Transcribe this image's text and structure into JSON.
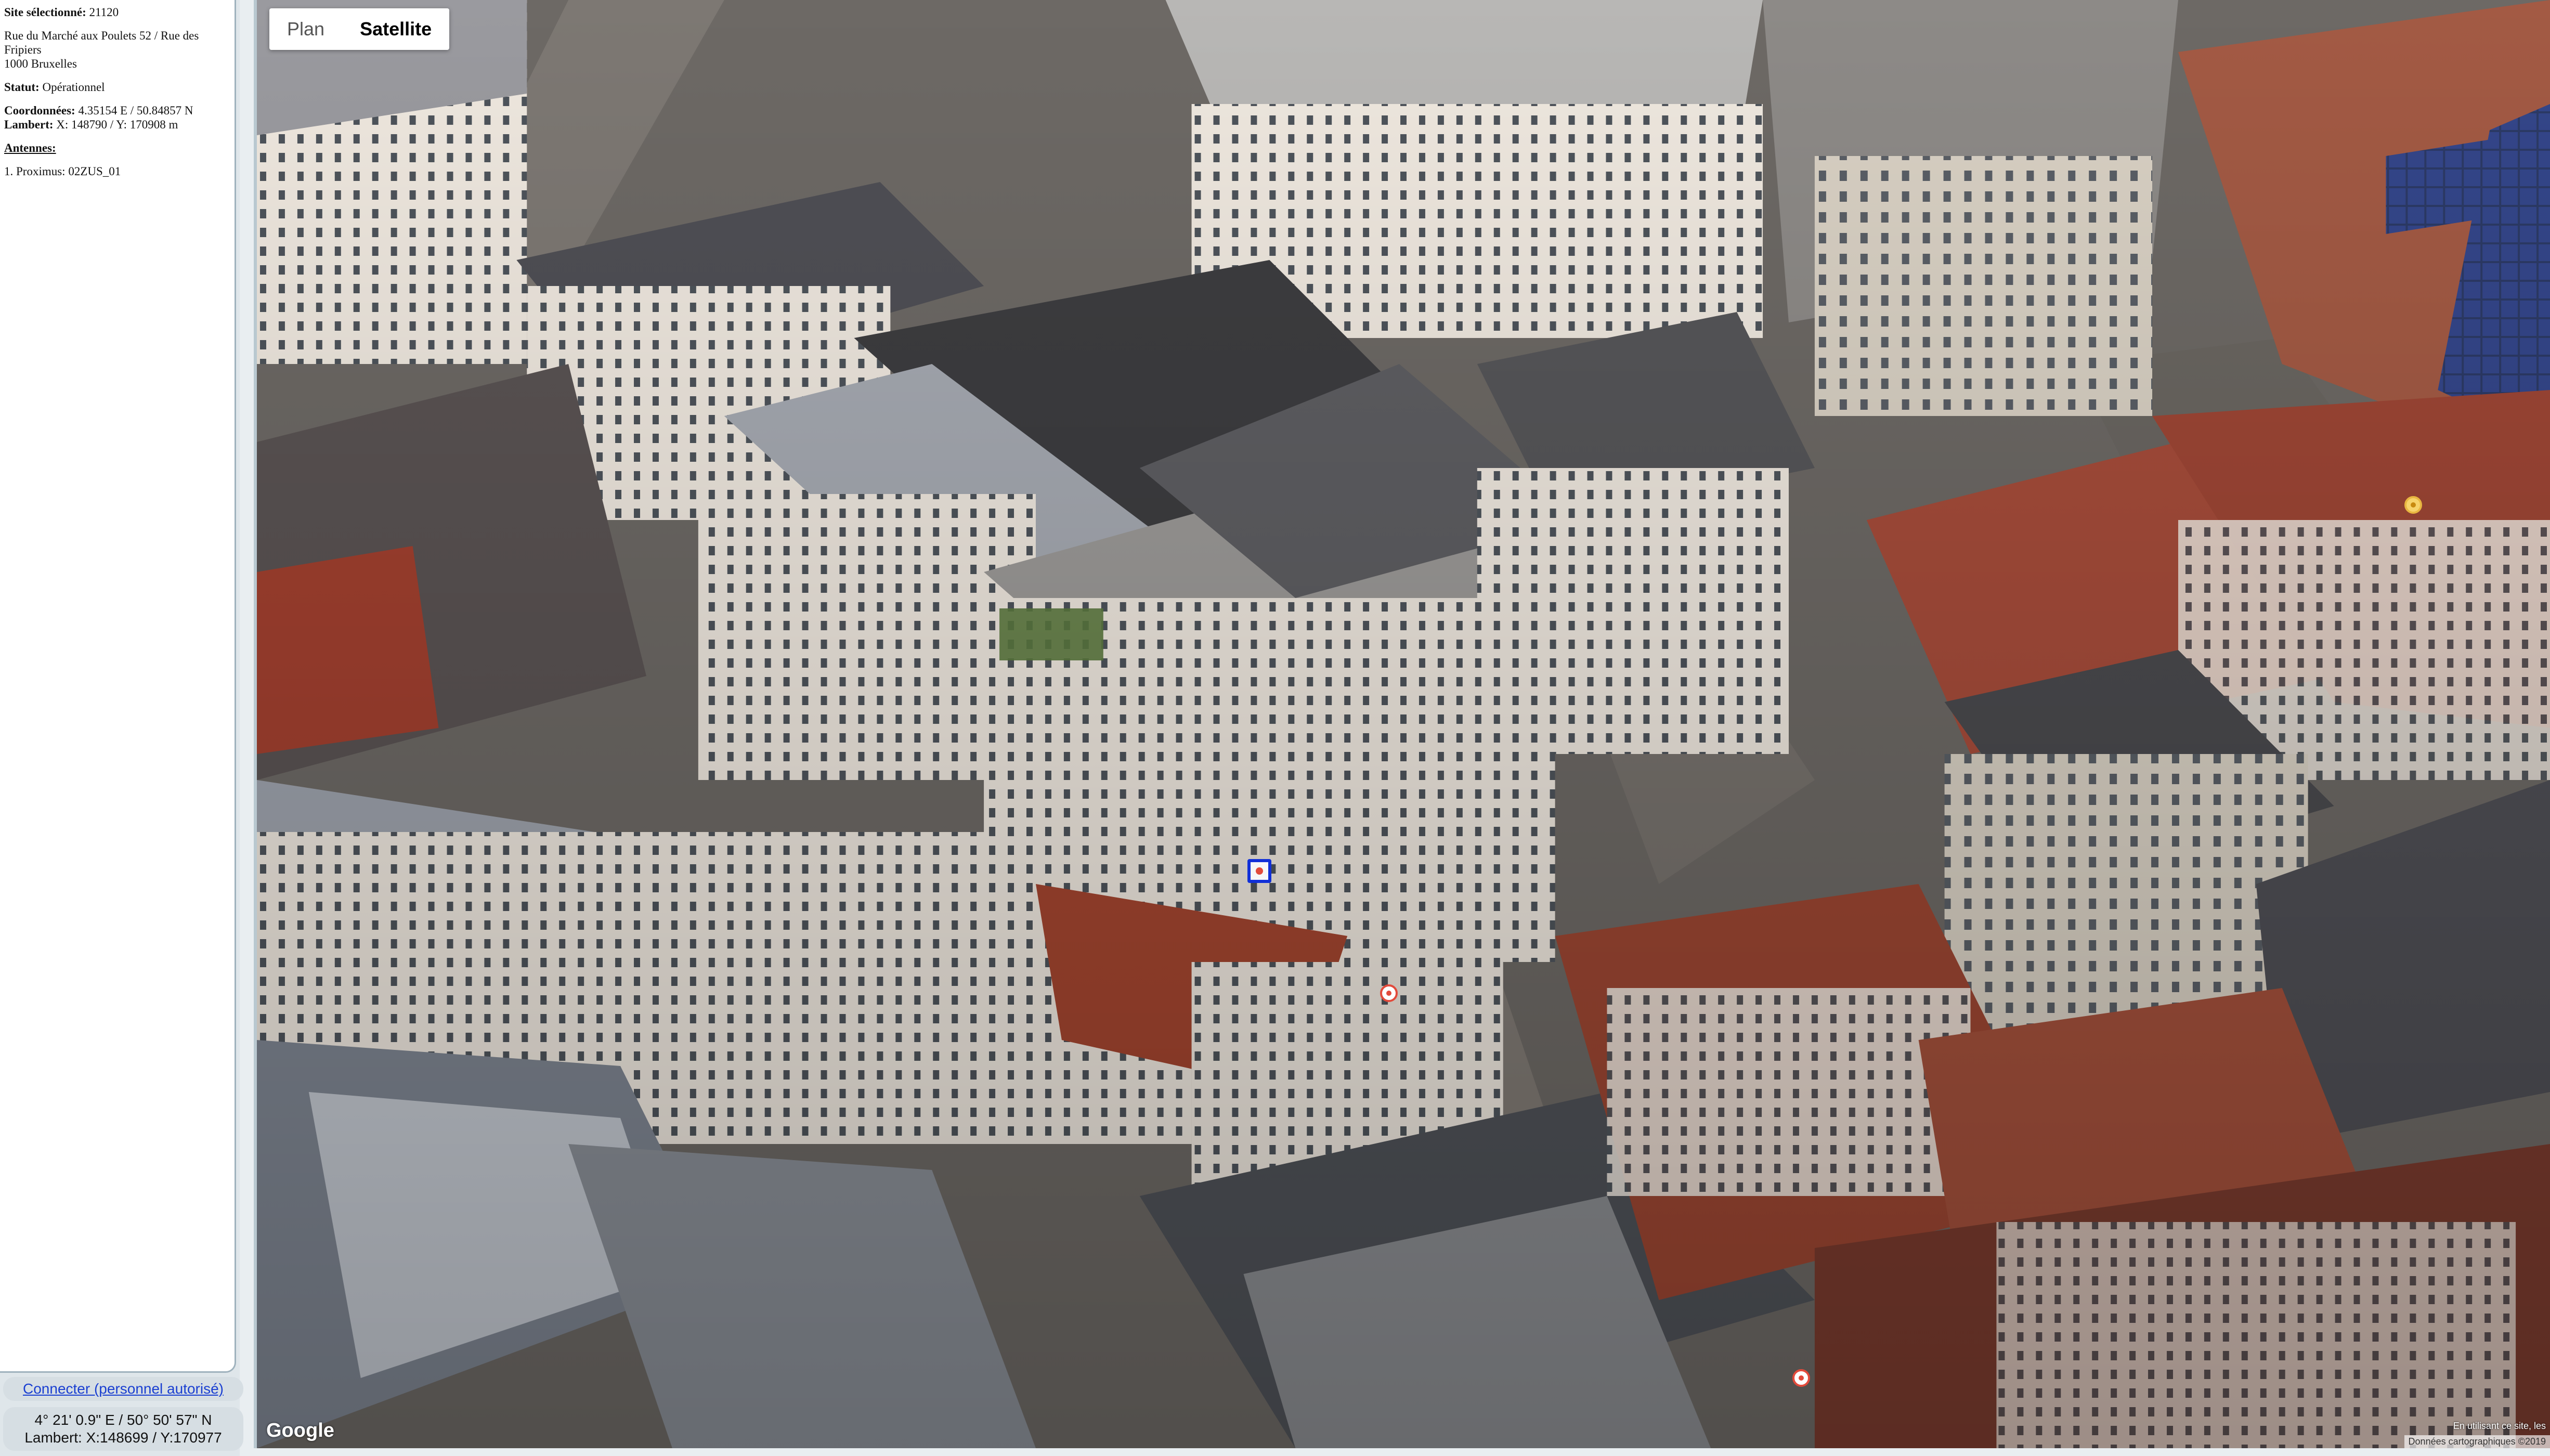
{
  "site": {
    "label": "Site sélectionné:",
    "id": "21120",
    "address_line1": "Rue du Marché aux Poulets 52 / Rue des",
    "address_line2": "Fripiers",
    "address_line3": "1000 Bruxelles",
    "status_label": "Statut:",
    "status_value": "Opérationnel",
    "coords_label": "Coordonnées:",
    "coords_value": "4.35154 E / 50.84857 N",
    "lambert_label": "Lambert:",
    "lambert_value": "X: 148790 / Y: 170908 m",
    "antennas_label": "Antennes:",
    "antennas": [
      "1. Proximus: 02ZUS_01"
    ]
  },
  "login_link": "Connecter (personnel autorisé)",
  "cursor_coords": {
    "line1": "4° 21' 0.9\" E / 50° 50' 57\" N",
    "line2": "Lambert: X:148699 / Y:170977"
  },
  "map": {
    "type_options": [
      "Plan",
      "Satellite"
    ],
    "active_type": "Satellite",
    "logo": "Google",
    "attribution": "Données cartographiques ©2019",
    "attribution_terms": "En utilisant ce site, les",
    "markers": [
      {
        "name": "selected-site-marker",
        "kind": "selected"
      },
      {
        "name": "site-marker-1",
        "kind": "site"
      },
      {
        "name": "site-marker-2",
        "kind": "site"
      },
      {
        "name": "site-marker-3",
        "kind": "other"
      }
    ]
  },
  "colors": {
    "link": "#1a3fd1",
    "selected_marker": "#1130d8",
    "site_marker": "#e24a3b",
    "panel_border": "#9fb2bd"
  }
}
